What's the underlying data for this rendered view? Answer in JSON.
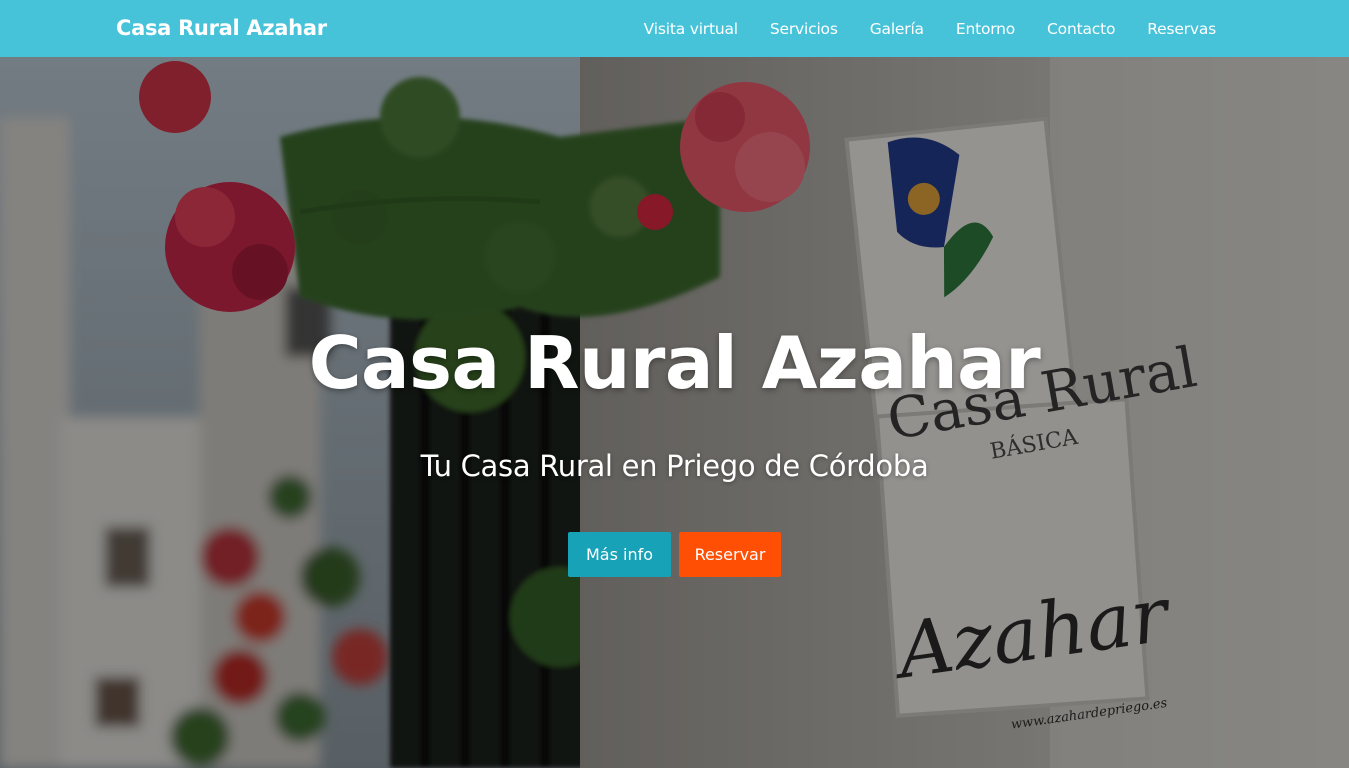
{
  "nav": {
    "brand": "Casa Rural Azahar",
    "links": [
      {
        "label": "Visita virtual"
      },
      {
        "label": "Servicios"
      },
      {
        "label": "Galería"
      },
      {
        "label": "Entorno"
      },
      {
        "label": "Contacto"
      },
      {
        "label": "Reservas"
      }
    ]
  },
  "hero": {
    "title": "Casa Rural Azahar",
    "subtitle": "Tu Casa Rural en Priego de Córdoba",
    "buttons": {
      "more_info": "Más info",
      "reserve": "Reservar"
    },
    "sign": {
      "line1": "Casa Rural",
      "line2": "BÁSICA",
      "name": "Azahar",
      "web": "www.azahardepriego.es"
    }
  },
  "colors": {
    "navbar": "#46c3d9",
    "btn_info": "#17a2b8",
    "btn_reserve": "#ff4f05"
  }
}
